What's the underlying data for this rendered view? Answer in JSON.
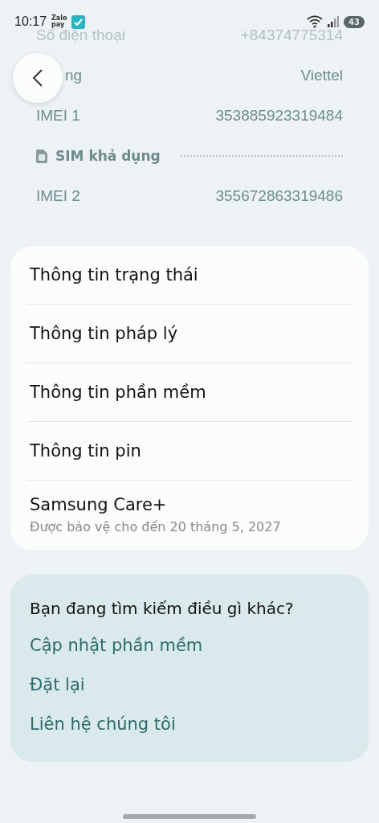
{
  "status_bar": {
    "time": "10:17",
    "notification": {
      "line_1": "Zalo",
      "line_2": "pay"
    },
    "battery": "43"
  },
  "info_rows": [
    {
      "kind": "pair",
      "label": "Số điện thoại",
      "value": "+84374775314",
      "faded": true
    },
    {
      "kind": "covered",
      "label": "ng",
      "value": "Viettel",
      "faded": false
    },
    {
      "kind": "pair",
      "label": "IMEI 1",
      "value": "353885923319484",
      "faded": false
    },
    {
      "kind": "sim",
      "label": "SIM khả dụng",
      "faded": false
    },
    {
      "kind": "pair",
      "label": "IMEI 2",
      "value": "355672863319486",
      "faded": false
    }
  ],
  "menu": [
    {
      "title": "Thông tin trạng thái"
    },
    {
      "title": "Thông tin pháp lý"
    },
    {
      "title": "Thông tin phần mềm"
    },
    {
      "title": "Thông tin pin"
    },
    {
      "title": "Samsung Care+",
      "subtitle": "Được bảo vệ cho đến 20 tháng 5, 2027"
    }
  ],
  "suggestions": {
    "title": "Bạn đang tìm kiếm điều gì khác?",
    "links": [
      "Cập nhật phần mềm",
      "Đặt lại",
      "Liên hệ chúng tôi"
    ]
  }
}
